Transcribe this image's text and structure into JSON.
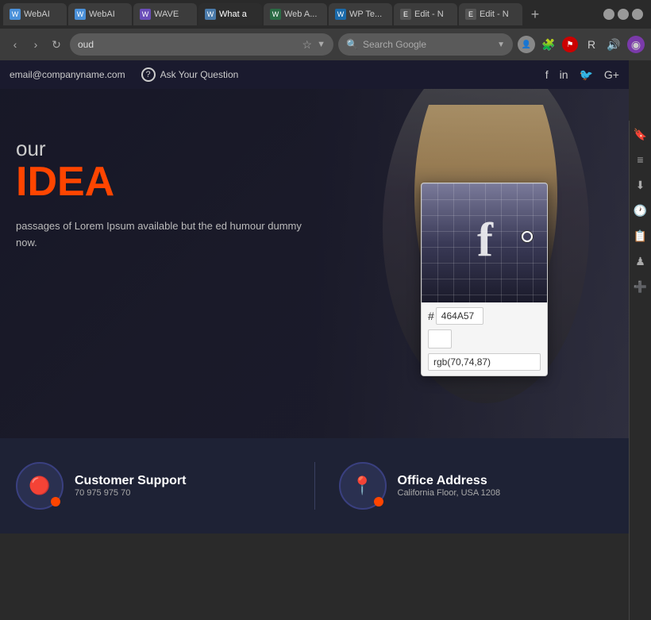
{
  "browser": {
    "tabs": [
      {
        "id": "tab1",
        "label": "WebAI",
        "favicon": "W",
        "active": false
      },
      {
        "id": "tab2",
        "label": "WebAI",
        "favicon": "W",
        "active": false
      },
      {
        "id": "tab3",
        "label": "WAVE",
        "favicon": "W",
        "active": false
      },
      {
        "id": "tab4",
        "label": "What a",
        "favicon": "W",
        "active": true
      },
      {
        "id": "tab5",
        "label": "Web A...",
        "favicon": "W",
        "active": false
      },
      {
        "id": "tab6",
        "label": "WP Te...",
        "favicon": "W",
        "active": false
      },
      {
        "id": "tab7",
        "label": "Edit - N",
        "favicon": "E",
        "active": false
      },
      {
        "id": "tab8",
        "label": "Edit - N",
        "favicon": "E",
        "active": false
      }
    ],
    "url": "oud",
    "search_placeholder": "Search Google",
    "window_controls": {
      "minimize": "–",
      "maximize": "□",
      "close": "✕"
    }
  },
  "info_bar": {
    "email": "email@companyname.com",
    "question_label": "Ask Your Question",
    "socials": [
      "f",
      "in",
      "t",
      "G+"
    ]
  },
  "hero": {
    "subtitle": "our",
    "title": "IDEA",
    "description": "passages of Lorem Ipsum available but the\ned humour dummy now."
  },
  "color_picker": {
    "hash_symbol": "#",
    "hex_value": "464A57",
    "rgb_value": "rgb(70,74,87)",
    "facebook_letter": "f",
    "arrow": "→"
  },
  "footer": {
    "cards": [
      {
        "icon": "🔴",
        "icon_emoji": "⊕",
        "title": "Customer Support",
        "subtitle": "70 975 975 70",
        "dot_color": "#ff4500"
      },
      {
        "icon": "📍",
        "title": "Office Address",
        "subtitle": "California Floor, USA\n1208",
        "dot_color": "#ff4500"
      }
    ]
  },
  "sidebar_icons": [
    "🔖",
    "≡",
    "⬇",
    "🕐",
    "📋",
    "♟",
    "➕"
  ]
}
